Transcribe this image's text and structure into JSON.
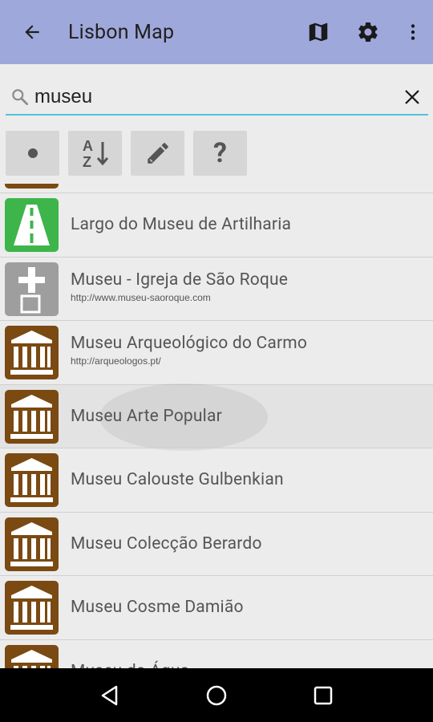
{
  "appbar": {
    "title": "Lisbon Map",
    "background": "#9fa8da",
    "actions": [
      "back-arrow-icon",
      "map-icon",
      "settings-gear-icon",
      "more-vert-icon"
    ]
  },
  "search": {
    "value": "museu",
    "placeholder": "",
    "underline_color": "#4fc3d9"
  },
  "tools": [
    {
      "name": "dot-filter-button",
      "icon": "dot-icon"
    },
    {
      "name": "sort-az-button",
      "icon": "sort-alpha-icon"
    },
    {
      "name": "edit-button",
      "icon": "pencil-icon"
    },
    {
      "name": "help-button",
      "icon": "question-icon",
      "label": "?"
    }
  ],
  "list": {
    "items": [
      {
        "name": "Largo do Museu de Artilharia",
        "url": "",
        "icon": "road-icon",
        "icon_color": "#3db54a"
      },
      {
        "name": "Museu - Igreja de São Roque",
        "url": "http://www.museu-saoroque.com",
        "icon": "church-cross-icon",
        "icon_color": "#9e9e9e"
      },
      {
        "name": "Museu Arqueológico do Carmo",
        "url": "http://arqueologos.pt/",
        "icon": "museum-icon",
        "icon_color": "#7a4a12"
      },
      {
        "name": "Museu Arte Popular",
        "url": "",
        "icon": "museum-icon",
        "icon_color": "#7a4a12"
      },
      {
        "name": "Museu Calouste Gulbenkian",
        "url": "",
        "icon": "museum-icon",
        "icon_color": "#7a4a12"
      },
      {
        "name": "Museu Colecção Berardo",
        "url": "",
        "icon": "museum-icon",
        "icon_color": "#7a4a12"
      },
      {
        "name": "Museu Cosme Damião",
        "url": "",
        "icon": "museum-icon",
        "icon_color": "#7a4a12"
      },
      {
        "name": "Museu da Água",
        "url": "",
        "icon": "museum-icon",
        "icon_color": "#7a4a12"
      }
    ]
  },
  "navbar": [
    "nav-back-icon",
    "nav-home-icon",
    "nav-recents-icon"
  ]
}
